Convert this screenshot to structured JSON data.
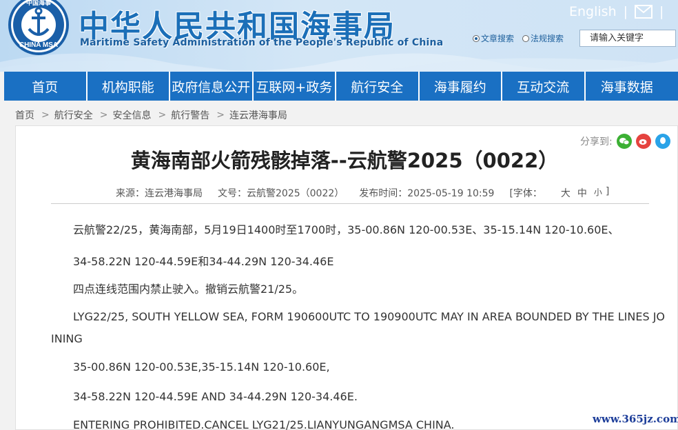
{
  "header": {
    "title_cn": "中华人民共和国海事局",
    "title_en": "Maritime Safety Administration of the People's Republic of China",
    "logo_text_top": "中国海事",
    "logo_text_bottom": "CHINA MSA",
    "english_link": "English",
    "separator": "|",
    "search": {
      "radio_article": "文章搜索",
      "radio_regulation": "法规搜索",
      "selected": "文章搜索",
      "placeholder": "请输入关键字"
    }
  },
  "nav": {
    "items": [
      "首页",
      "机构职能",
      "政府信息公开",
      "互联网+政务",
      "航行安全",
      "海事履约",
      "互动交流",
      "海事数据"
    ]
  },
  "breadcrumb": {
    "items": [
      "首页",
      "航行安全",
      "安全信息",
      "航行警告",
      "连云港海事局"
    ],
    "arrow": ">"
  },
  "share": {
    "label": "分享到:",
    "icons": [
      "wechat-icon",
      "weibo-icon",
      "qq-icon"
    ]
  },
  "article": {
    "title": "黄海南部火箭残骸掉落--云航警2025（0022）",
    "meta": {
      "source": "来源：连云港海事局",
      "doc_no": "文号：云航警2025（0022）",
      "published": "发布时间：2025-05-19 10:59",
      "font_label": "[字体：",
      "font_large": "大",
      "font_medium": "中",
      "font_small": "小",
      "font_close": "]"
    },
    "paragraphs": [
      "云航警22/25，黄海南部，5月19日1400时至1700时，35-00.86N 120-00.53E、35-15.14N 120-10.60E、",
      "34-58.22N 120-44.59E和34-44.29N 120-34.46E",
      "四点连线范围内禁止驶入。撤销云航警21/25。",
      "LYG22/25, SOUTH YELLOW SEA, FORM 190600UTC TO 190900UTC MAY IN AREA BOUNDED BY THE LINES JO",
      "INING",
      "35-00.86N 120-00.53E,35-15.14N 120-10.60E,",
      "34-58.22N 120-44.59E AND 34-44.29N 120-34.46E.",
      "ENTERING PROHIBITED.CANCEL LYG21/25.LIANYUNGANGMSA CHINA."
    ]
  },
  "watermark": "www.365jz.com",
  "colors": {
    "nav_bg": "#1a70c3",
    "title_blue": "#1b6fb8",
    "header_bg": "#cfe3f5"
  }
}
